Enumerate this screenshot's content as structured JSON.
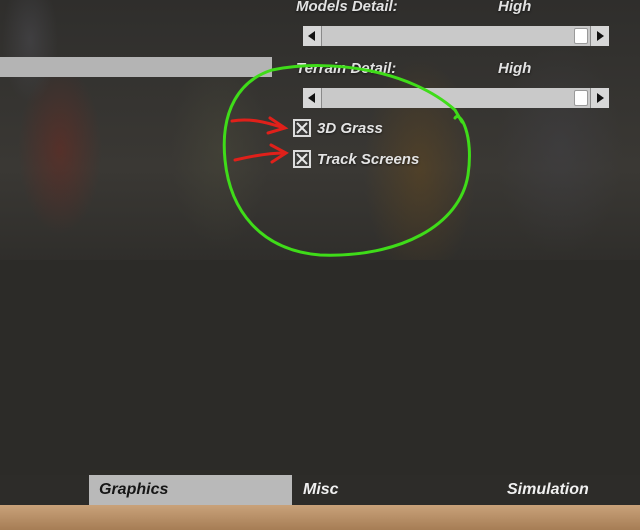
{
  "settings": {
    "models_detail": {
      "label": "Models Detail:",
      "value": "High",
      "level": 1.0
    },
    "terrain_detail": {
      "label": "Terrain Detail:",
      "value": "High",
      "level": 1.0
    },
    "grass_3d": {
      "label": "3D Grass",
      "checked": true
    },
    "track_screens": {
      "label": "Track Screens",
      "checked": true
    }
  },
  "tabs": [
    {
      "label": "Graphics",
      "active": true
    },
    {
      "label": "Misc",
      "active": false
    },
    {
      "label": "Simulation",
      "active": false
    }
  ],
  "colors": {
    "annotation_circle": "#3fdc19",
    "annotation_arrow": "#e0201a",
    "active_tab": "#b9b9b9"
  }
}
